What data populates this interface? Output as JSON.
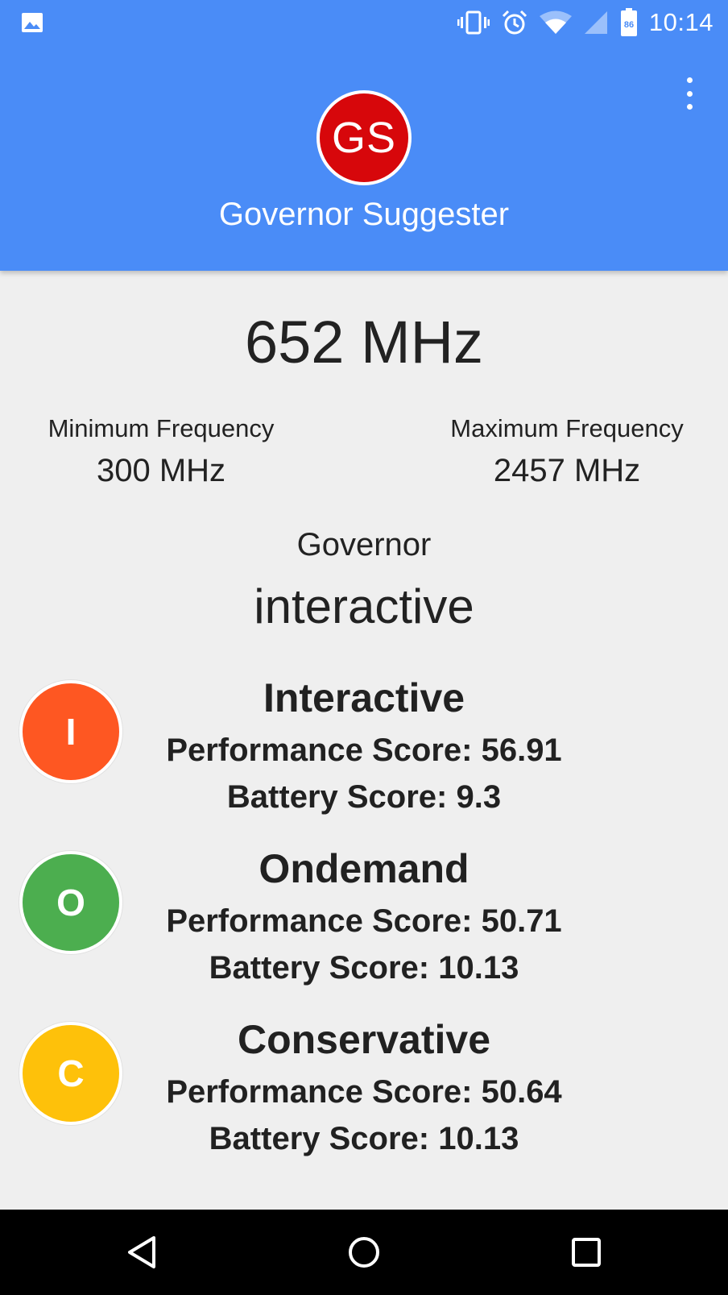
{
  "status_bar": {
    "time": "10:14",
    "battery_level": "86",
    "left_icon": "image-icon",
    "right_icons": [
      "vibrate-icon",
      "alarm-icon",
      "wifi-icon",
      "cell-signal-icon",
      "battery-icon"
    ]
  },
  "app_bar": {
    "logo_text": "GS",
    "title": "Governor Suggester",
    "menu_icon": "overflow-menu-icon",
    "colors": {
      "background": "#4a8cf7",
      "logo": "#d7070b"
    }
  },
  "cpu": {
    "current_frequency": "652 MHz",
    "min_label": "Minimum Frequency",
    "min_value": "300 MHz",
    "max_label": "Maximum Frequency",
    "max_value": "2457 MHz"
  },
  "governor": {
    "label": "Governor",
    "value": "interactive"
  },
  "suggestions": [
    {
      "letter": "I",
      "name": "Interactive",
      "performance": "Performance Score: 56.91",
      "battery": "Battery Score: 9.3",
      "color": "#fe5722"
    },
    {
      "letter": "O",
      "name": "Ondemand",
      "performance": "Performance Score: 50.71",
      "battery": "Battery Score: 10.13",
      "color": "#4cae4f"
    },
    {
      "letter": "C",
      "name": "Conservative",
      "performance": "Performance Score: 50.64",
      "battery": "Battery Score: 10.13",
      "color": "#fec10a"
    }
  ],
  "nav_bar": {
    "buttons": [
      "back-icon",
      "home-icon",
      "recents-icon"
    ]
  }
}
